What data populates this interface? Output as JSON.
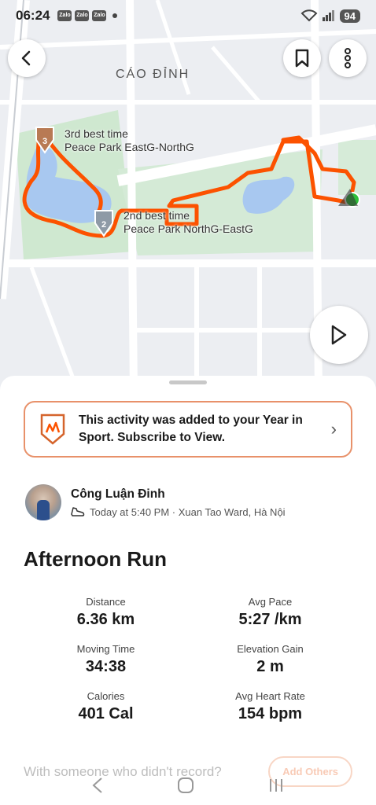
{
  "status_bar": {
    "time": "06:24",
    "app_badges": [
      "Zalo",
      "Zalo",
      "Zalo"
    ],
    "battery": "94"
  },
  "map": {
    "place_name": "CÁO ĐỈNH",
    "segments": [
      {
        "line1": "3rd best time",
        "line2": "Peace Park EastG-NorthG",
        "medal": "3"
      },
      {
        "line1": "2nd best time",
        "line2": "Peace Park NorthG-EastG",
        "medal": "2"
      }
    ],
    "route_color": "#fc5200"
  },
  "promo": {
    "text": "This activity was added to your Year in Sport. Subscribe to View."
  },
  "athlete": {
    "name": "Công Luận Đinh",
    "meta": "Today at 5:40 PM · Xuan Tao Ward, Hà Nội"
  },
  "activity": {
    "title": "Afternoon Run",
    "stats": [
      {
        "label": "Distance",
        "value": "6.36 km"
      },
      {
        "label": "Avg Pace",
        "value": "5:27 /km"
      },
      {
        "label": "Moving Time",
        "value": "34:38"
      },
      {
        "label": "Elevation Gain",
        "value": "2 m"
      },
      {
        "label": "Calories",
        "value": "401 Cal"
      },
      {
        "label": "Avg Heart Rate",
        "value": "154 bpm"
      }
    ]
  },
  "footer": {
    "record_prompt": "With someone who didn't record?",
    "add_others_label": "Add Others"
  },
  "accent_color": "#fc5200"
}
